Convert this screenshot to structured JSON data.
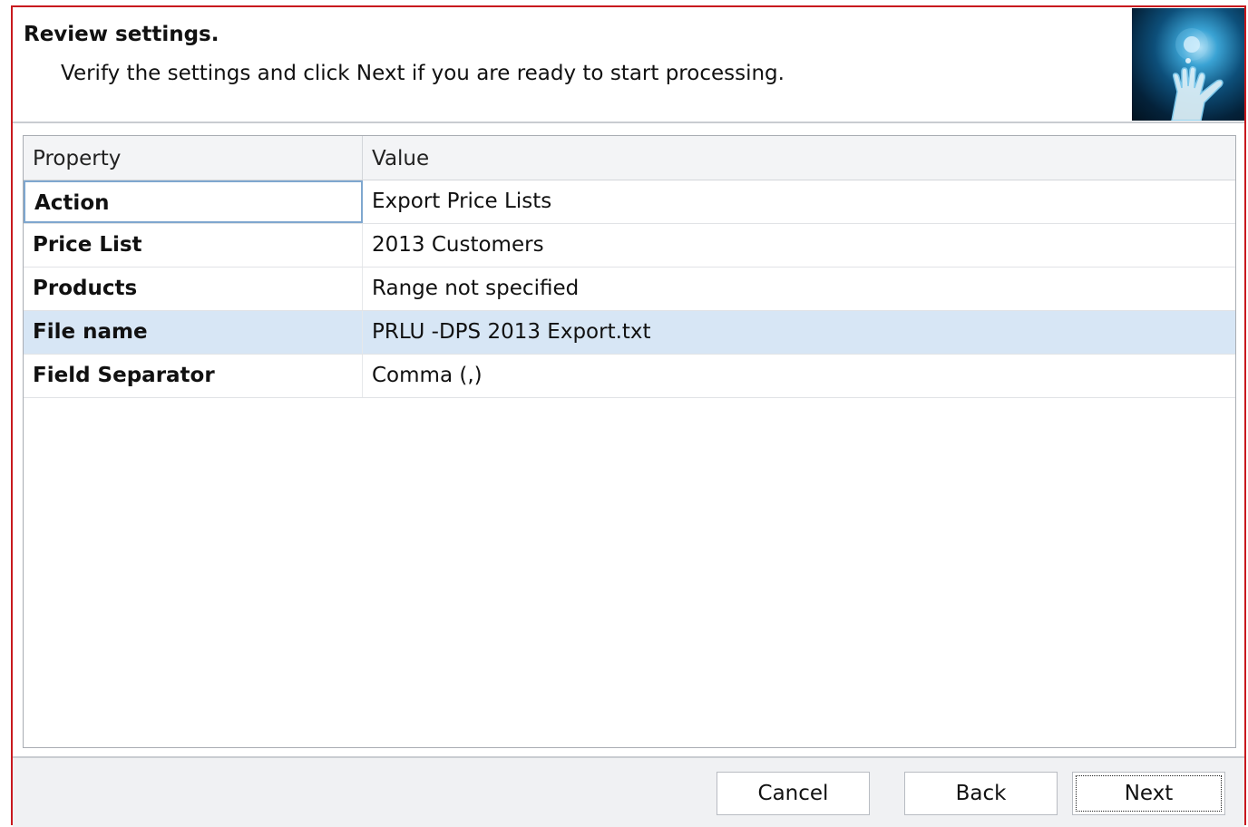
{
  "header": {
    "title": "Review settings.",
    "subtitle": "Verify the settings and click Next if you are ready to start processing.",
    "image_icon": "hand-reaching-light-icon"
  },
  "grid": {
    "columns": [
      "Property",
      "Value"
    ],
    "rows": [
      {
        "property": "Action",
        "value": "Export Price Lists"
      },
      {
        "property": "Price List",
        "value": "2013 Customers"
      },
      {
        "property": "Products",
        "value": "Range not specified"
      },
      {
        "property": "File name",
        "value": "PRLU -DPS 2013 Export.txt"
      },
      {
        "property": "Field Separator",
        "value": "Comma (,)"
      }
    ],
    "selected_row_index": 3,
    "focused_row_index": 0
  },
  "buttons": {
    "cancel": "Cancel",
    "back": "Back",
    "next": "Next"
  },
  "colors": {
    "frame_border": "#c8191e",
    "selected_row": "#d7e6f5",
    "focus_cell_border": "#7fa7cf",
    "footer_bg": "#f0f1f3"
  }
}
